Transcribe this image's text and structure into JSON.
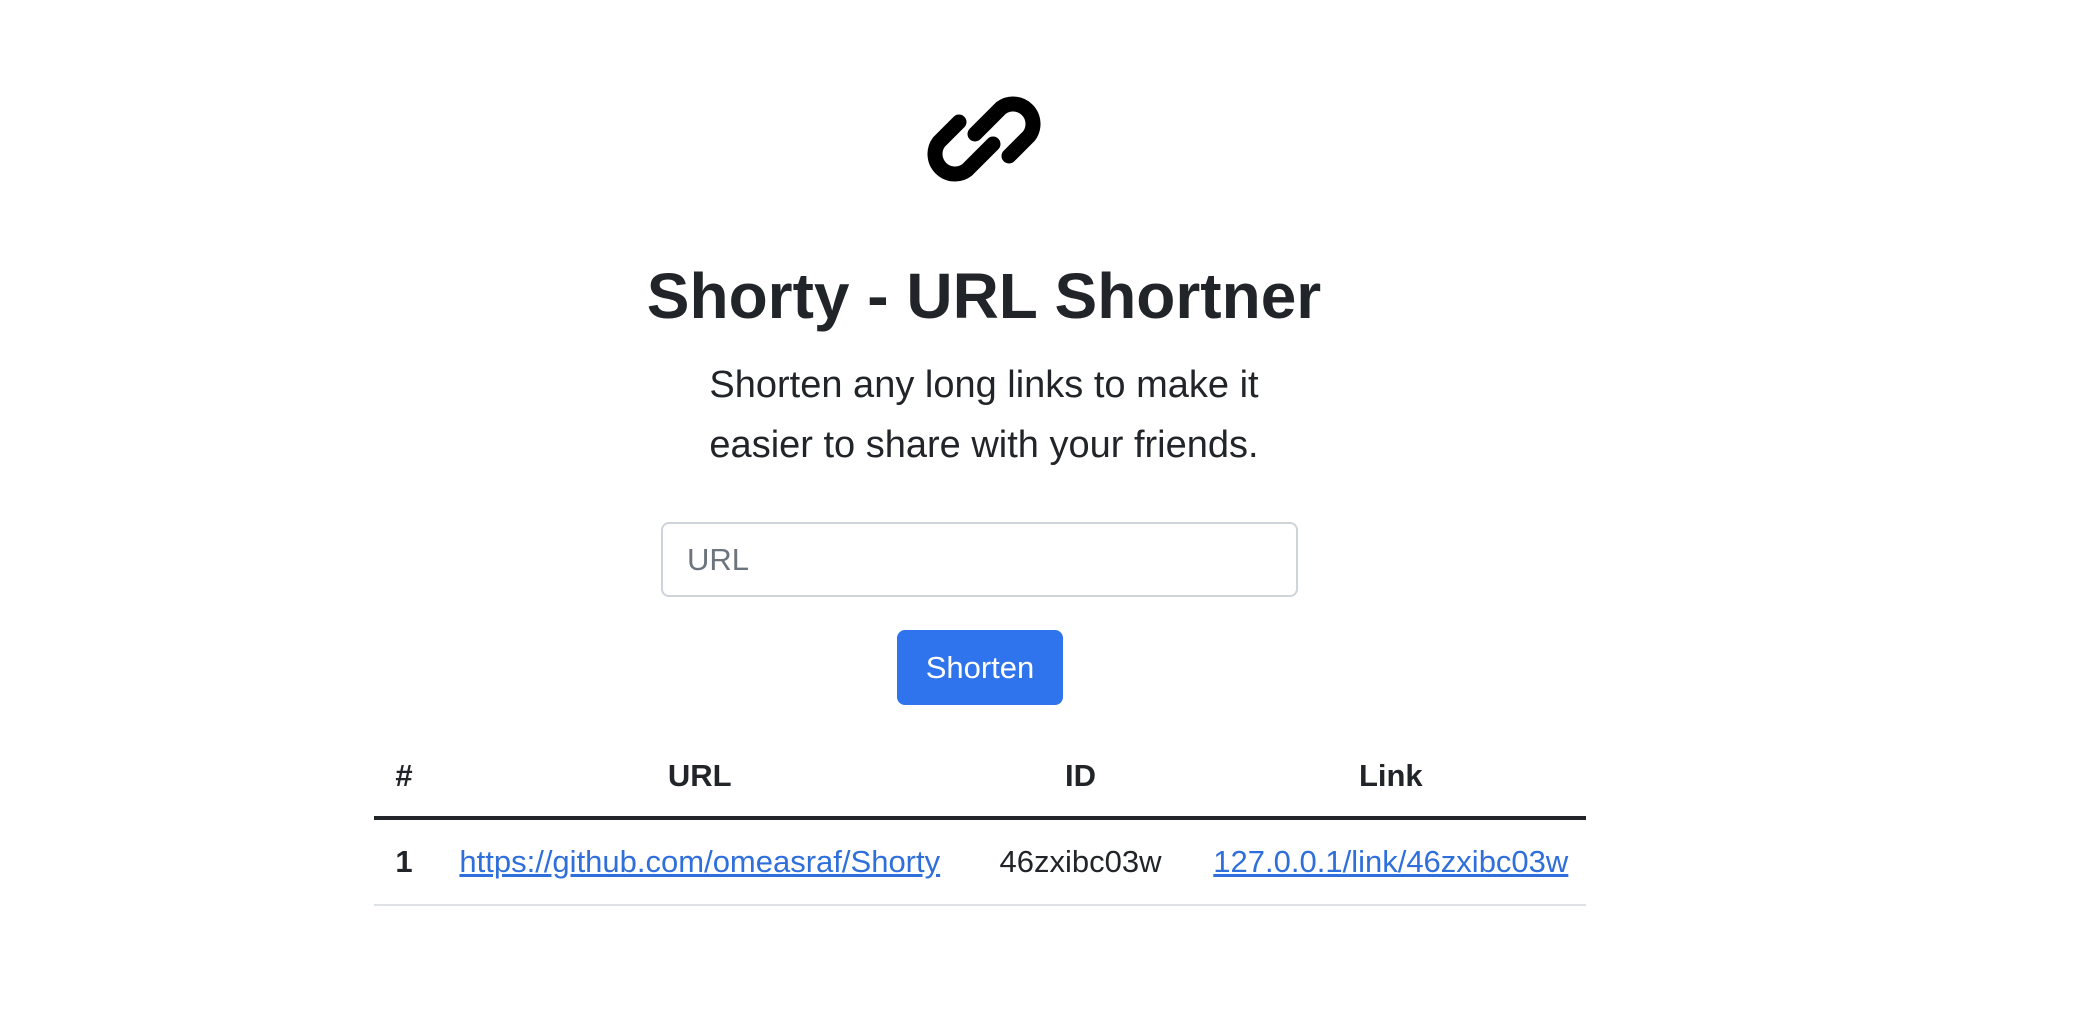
{
  "header": {
    "logo_icon": "link-icon",
    "title": "Shorty - URL Shortner",
    "subtitle": "Shorten any long links to make it easier to share with your friends."
  },
  "form": {
    "url_placeholder": "URL",
    "url_value": "",
    "submit_label": "Shorten"
  },
  "table": {
    "columns": [
      "#",
      "URL",
      "ID",
      "Link"
    ],
    "rows": [
      {
        "index": "1",
        "url": "https://github.com/omeasraf/Shorty",
        "id": "46zxibc03w",
        "link": "127.0.0.1/link/46zxibc03w"
      }
    ]
  },
  "colors": {
    "primary": "#2f74ec",
    "link": "#2f6fdc",
    "text": "#212529"
  }
}
